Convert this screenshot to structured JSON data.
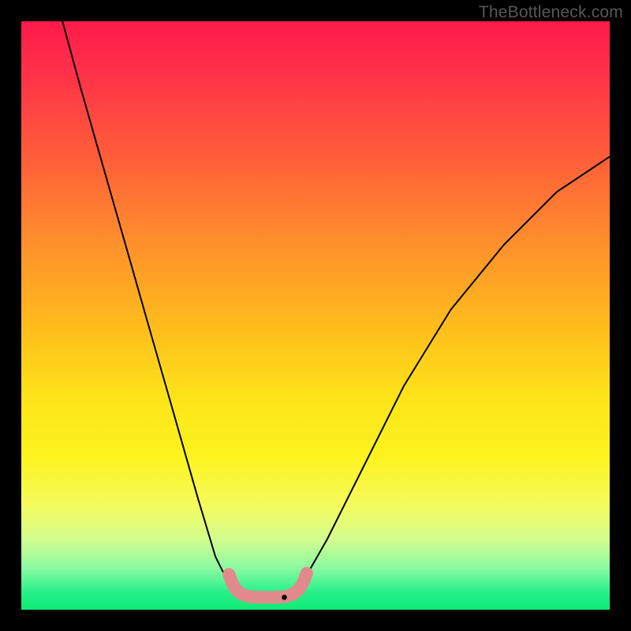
{
  "watermark": "TheBottleneck.com",
  "chart_data": {
    "type": "line",
    "title": "",
    "xlabel": "",
    "ylabel": "",
    "xlim": [
      0,
      100
    ],
    "ylim": [
      0,
      100
    ],
    "grid": false,
    "legend": false,
    "gradient_stops": [
      {
        "pos": 0,
        "color": "#ff1a4a"
      },
      {
        "pos": 8,
        "color": "#ff2f4a"
      },
      {
        "pos": 22,
        "color": "#ff5a3a"
      },
      {
        "pos": 36,
        "color": "#ff8a2e"
      },
      {
        "pos": 52,
        "color": "#ffbd1c"
      },
      {
        "pos": 64,
        "color": "#fde419"
      },
      {
        "pos": 74,
        "color": "#fcf31e"
      },
      {
        "pos": 82,
        "color": "#f6fb5c"
      },
      {
        "pos": 88,
        "color": "#d4fd8e"
      },
      {
        "pos": 93,
        "color": "#8af9a2"
      },
      {
        "pos": 97,
        "color": "#27f08a"
      },
      {
        "pos": 100,
        "color": "#0feb75"
      }
    ],
    "series": [
      {
        "name": "left-curve",
        "color": "#000000",
        "x": [
          7,
          10,
          14,
          18,
          22,
          26,
          30,
          33,
          35,
          37.5
        ],
        "y": [
          100,
          89,
          75,
          61,
          47,
          33,
          19,
          9,
          5,
          2.3
        ]
      },
      {
        "name": "right-curve",
        "color": "#000000",
        "x": [
          46,
          48,
          52,
          58,
          65,
          73,
          82,
          91,
          100
        ],
        "y": [
          2.3,
          5,
          12,
          24,
          38,
          51,
          62,
          71,
          77
        ]
      },
      {
        "name": "bottom-notch-overlay",
        "color": "#e2898b",
        "x": [
          35.3,
          35.8,
          36.5,
          37.5,
          38.8,
          40.5,
          43.0,
          45.0,
          46.3,
          47.3,
          48.0,
          48.5
        ],
        "y": [
          6.0,
          4.6,
          3.4,
          2.6,
          2.2,
          2.1,
          2.1,
          2.2,
          2.7,
          3.6,
          4.8,
          6.2
        ]
      }
    ],
    "notch_dot": {
      "x": 44.7,
      "y": 2.1,
      "color": "#000000"
    }
  }
}
